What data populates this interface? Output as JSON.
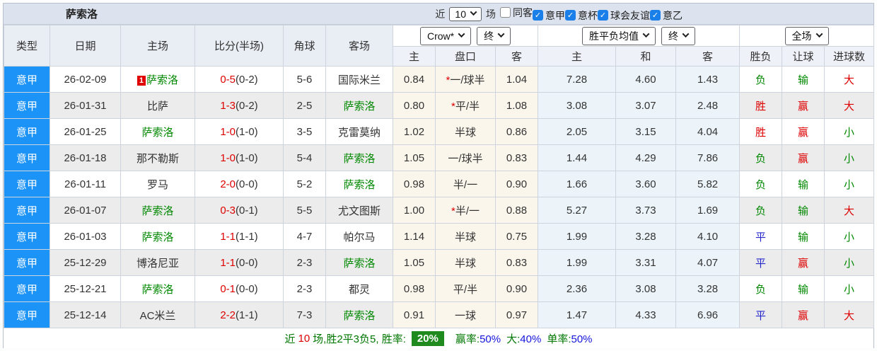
{
  "title": "萨索洛",
  "team_self": "萨索洛",
  "filters": {
    "recent_label": "近",
    "recent_value": "10",
    "games_label": "场",
    "checkboxes": [
      {
        "label": "同客",
        "checked": false
      },
      {
        "label": "意甲",
        "checked": true
      },
      {
        "label": "意杯",
        "checked": true
      },
      {
        "label": "球会友谊",
        "checked": true
      },
      {
        "label": "意乙",
        "checked": true
      }
    ]
  },
  "selectors": {
    "company": "Crow*",
    "company_time": "终",
    "avg": "胜平负均值",
    "avg_time": "终",
    "scope": "全场"
  },
  "columns": {
    "type": "类型",
    "date": "日期",
    "home": "主场",
    "score": "比分(半场)",
    "corner": "角球",
    "away": "客场",
    "odds_home": "主",
    "handicap": "盘口",
    "odds_away": "客",
    "avg_home": "主",
    "avg_draw": "和",
    "avg_away": "客",
    "result": "胜负",
    "let_result": "让球",
    "goals": "进球数"
  },
  "rows": [
    {
      "type": "意甲",
      "date": "26-02-09",
      "home": "萨索洛",
      "home_badge": "1",
      "ft": "0-5",
      "ht": "0-2",
      "corner": "5-6",
      "away": "国际米兰",
      "odds_home": "0.84",
      "handicap": "*一/球半",
      "odds_away": "1.04",
      "avg_home": "7.28",
      "avg_draw": "4.60",
      "avg_away": "1.43",
      "result": "负",
      "let": "输",
      "goal": "大"
    },
    {
      "type": "意甲",
      "date": "26-01-31",
      "home": "比萨",
      "ft": "1-3",
      "ht": "0-2",
      "corner": "2-5",
      "away": "萨索洛",
      "odds_home": "0.80",
      "handicap": "*平/半",
      "odds_away": "1.08",
      "avg_home": "3.08",
      "avg_draw": "3.07",
      "avg_away": "2.48",
      "result": "胜",
      "let": "赢",
      "goal": "大"
    },
    {
      "type": "意甲",
      "date": "26-01-25",
      "home": "萨索洛",
      "ft": "1-0",
      "ht": "1-0",
      "corner": "3-5",
      "away": "克雷莫纳",
      "odds_home": "1.02",
      "handicap": "半球",
      "odds_away": "0.86",
      "avg_home": "2.05",
      "avg_draw": "3.15",
      "avg_away": "4.04",
      "result": "胜",
      "let": "赢",
      "goal": "小"
    },
    {
      "type": "意甲",
      "date": "26-01-18",
      "home": "那不勒斯",
      "ft": "1-0",
      "ht": "1-0",
      "corner": "5-4",
      "away": "萨索洛",
      "odds_home": "1.05",
      "handicap": "一/球半",
      "odds_away": "0.83",
      "avg_home": "1.44",
      "avg_draw": "4.29",
      "avg_away": "7.86",
      "result": "负",
      "let": "赢",
      "goal": "小"
    },
    {
      "type": "意甲",
      "date": "26-01-11",
      "home": "罗马",
      "ft": "2-0",
      "ht": "0-0",
      "corner": "5-2",
      "away": "萨索洛",
      "odds_home": "0.98",
      "handicap": "半/一",
      "odds_away": "0.90",
      "avg_home": "1.66",
      "avg_draw": "3.60",
      "avg_away": "5.82",
      "result": "负",
      "let": "输",
      "goal": "小"
    },
    {
      "type": "意甲",
      "date": "26-01-07",
      "home": "萨索洛",
      "ft": "0-3",
      "ht": "0-1",
      "corner": "5-5",
      "away": "尤文图斯",
      "odds_home": "1.00",
      "handicap": "*半/一",
      "odds_away": "0.88",
      "avg_home": "5.27",
      "avg_draw": "3.73",
      "avg_away": "1.69",
      "result": "负",
      "let": "输",
      "goal": "大"
    },
    {
      "type": "意甲",
      "date": "26-01-03",
      "home": "萨索洛",
      "ft": "1-1",
      "ht": "1-1",
      "corner": "4-7",
      "away": "帕尔马",
      "odds_home": "1.14",
      "handicap": "半球",
      "odds_away": "0.75",
      "avg_home": "1.99",
      "avg_draw": "3.28",
      "avg_away": "4.10",
      "result": "平",
      "let": "输",
      "goal": "小"
    },
    {
      "type": "意甲",
      "date": "25-12-29",
      "home": "博洛尼亚",
      "ft": "1-1",
      "ht": "0-0",
      "corner": "2-3",
      "away": "萨索洛",
      "odds_home": "1.05",
      "handicap": "半球",
      "odds_away": "0.83",
      "avg_home": "1.99",
      "avg_draw": "3.31",
      "avg_away": "4.07",
      "result": "平",
      "let": "赢",
      "goal": "小"
    },
    {
      "type": "意甲",
      "date": "25-12-21",
      "home": "萨索洛",
      "ft": "0-1",
      "ht": "0-0",
      "corner": "2-3",
      "away": "都灵",
      "odds_home": "0.98",
      "handicap": "平/半",
      "odds_away": "0.90",
      "avg_home": "2.36",
      "avg_draw": "3.08",
      "avg_away": "3.28",
      "result": "负",
      "let": "输",
      "goal": "小"
    },
    {
      "type": "意甲",
      "date": "25-12-14",
      "home": "AC米兰",
      "ft": "2-2",
      "ht": "1-1",
      "corner": "7-3",
      "away": "萨索洛",
      "odds_home": "0.91",
      "handicap": "一球",
      "odds_away": "0.97",
      "avg_home": "1.47",
      "avg_draw": "4.33",
      "avg_away": "6.96",
      "result": "平",
      "let": "赢",
      "goal": "大"
    }
  ],
  "footer": {
    "part1": "近",
    "count": "10",
    "part2": "场,胜2平3负5, 胜率:",
    "win_rate_box": "20%",
    "stats": [
      {
        "label": "赢率:",
        "value": "50%"
      },
      {
        "label": "大:",
        "value": "40%"
      },
      {
        "label": "单率:",
        "value": "50%"
      }
    ]
  }
}
